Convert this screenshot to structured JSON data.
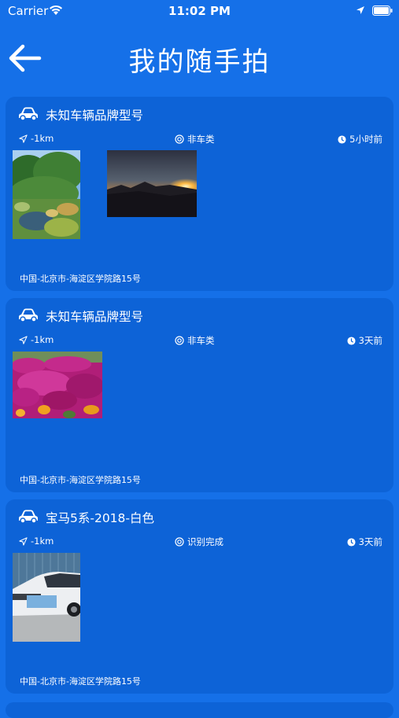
{
  "status_bar": {
    "carrier": "Carrier",
    "time": "11:02 PM"
  },
  "nav": {
    "title": "我的随手拍"
  },
  "cards": [
    {
      "title": "未知车辆品牌型号",
      "distance": "-1km",
      "classification": "非车类",
      "time": "5小时前",
      "address": "中国-北京市-海淀区学院路15号"
    },
    {
      "title": "未知车辆品牌型号",
      "distance": "-1km",
      "classification": "非车类",
      "time": "3天前",
      "address": "中国-北京市-海淀区学院路15号"
    },
    {
      "title": "宝马5系-2018-白色",
      "distance": "-1km",
      "classification": "识别完成",
      "time": "3天前",
      "address": "中国-北京市-海淀区学院路15号"
    }
  ],
  "colors": {
    "background": "#1570E8",
    "card": "#0D63D7",
    "text": "#FFFFFF"
  },
  "icons": [
    "wifi-icon",
    "location-arrow-icon",
    "battery-icon",
    "back-arrow-icon",
    "car-icon",
    "navigation-icon",
    "target-icon",
    "clock-icon"
  ]
}
